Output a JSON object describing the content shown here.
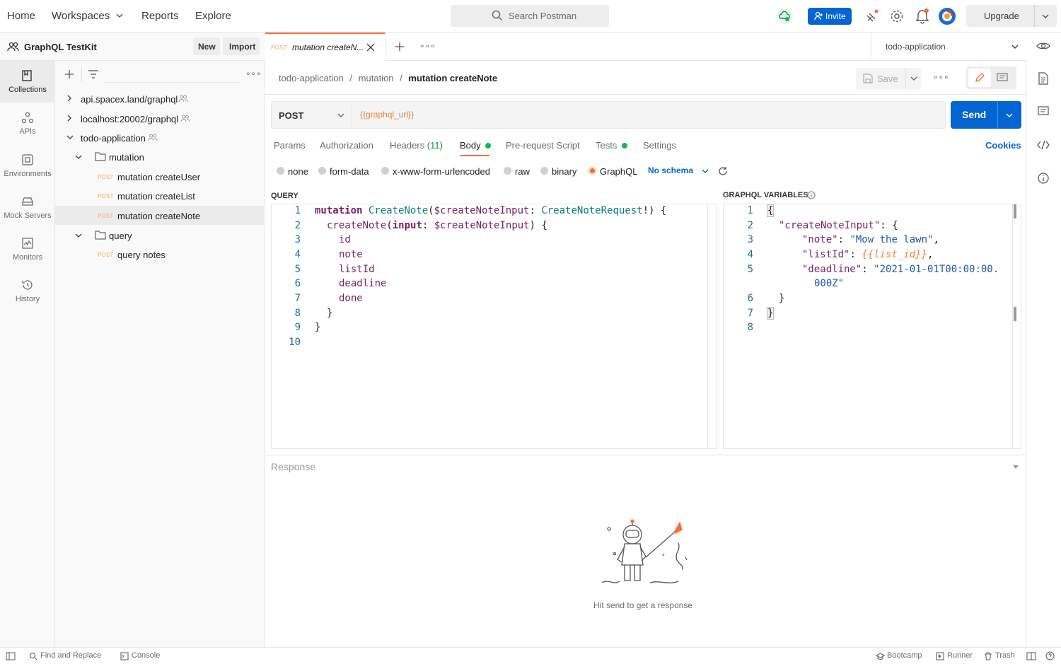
{
  "topbar": {
    "home": "Home",
    "workspaces": "Workspaces",
    "reports": "Reports",
    "explore": "Explore",
    "search_placeholder": "Search Postman",
    "invite": "Invite",
    "upgrade": "Upgrade"
  },
  "sidebar": {
    "workspace_name": "GraphQL TestKit",
    "new_label": "New",
    "import_label": "Import",
    "rail": [
      {
        "label": "Collections",
        "icon": "collections-icon"
      },
      {
        "label": "APIs",
        "icon": "apis-icon"
      },
      {
        "label": "Environments",
        "icon": "environments-icon"
      },
      {
        "label": "Mock Servers",
        "icon": "mock-servers-icon"
      },
      {
        "label": "Monitors",
        "icon": "monitors-icon"
      },
      {
        "label": "History",
        "icon": "history-icon"
      }
    ],
    "collections": [
      {
        "name": "api.spacex.land/graphql"
      },
      {
        "name": "localhost:20002/graphql"
      },
      {
        "name": "todo-application"
      }
    ],
    "folders": [
      {
        "name": "mutation"
      },
      {
        "name": "query"
      }
    ],
    "requests": [
      {
        "method": "POST",
        "name": "mutation createUser"
      },
      {
        "method": "POST",
        "name": "mutation createList"
      },
      {
        "method": "POST",
        "name": "mutation createNote"
      },
      {
        "method": "POST",
        "name": "query notes"
      }
    ]
  },
  "tab": {
    "method": "POST",
    "title": "mutation createN..."
  },
  "environment": "todo-application",
  "breadcrumb": {
    "collection": "todo-application",
    "folder": "mutation",
    "request": "mutation createNote",
    "sep1": "/",
    "sep2": "/"
  },
  "save_label": "Save",
  "request": {
    "method": "POST",
    "url": "{{graphql_url}}",
    "send": "Send"
  },
  "req_tabs": {
    "params": "Params",
    "authorization": "Authorization",
    "headers": "Headers",
    "headers_count": "(11)",
    "body": "Body",
    "prerequest": "Pre-request Script",
    "tests": "Tests",
    "settings": "Settings",
    "cookies": "Cookies"
  },
  "body_types": {
    "none": "none",
    "form_data": "form-data",
    "urlencoded": "x-www-form-urlencoded",
    "raw": "raw",
    "binary": "binary",
    "graphql": "GraphQL",
    "schema": "No schema"
  },
  "query_label": "QUERY",
  "variables_label": "GRAPHQL VARIABLES",
  "query_lines": [
    "1",
    "2",
    "3",
    "4",
    "5",
    "6",
    "7",
    "8",
    "9",
    "10"
  ],
  "variables_lines": [
    "1",
    "2",
    "3",
    "4",
    "5",
    "",
    "6",
    "7",
    "8"
  ],
  "query_code": {
    "l1_kw": "mutation",
    "l1_name": "CreateNote",
    "l1_open": "(",
    "l1_var": "$createNoteInput",
    "l1_colon": ": ",
    "l1_type": "CreateNoteRequest",
    "l1_close": "!) {",
    "l2_fn": "createNote",
    "l2_open": "(",
    "l2_arg": "input",
    "l2_colon": ": ",
    "l2_var": "$createNoteInput",
    "l2_close": ") {",
    "l3": "id",
    "l4": "note",
    "l5": "listId",
    "l6": "deadline",
    "l7": "done",
    "l8": "}",
    "l9": "}"
  },
  "variables_code": {
    "l1": "{",
    "l2_key": "\"createNoteInput\"",
    "l2_rest": ": {",
    "l3_key": "\"note\"",
    "l3_sep": ": ",
    "l3_val": "\"Mow the lawn\"",
    "l3_end": ",",
    "l4_key": "\"listId\"",
    "l4_sep": ": ",
    "l4_val": "{{list_id}}",
    "l4_end": ",",
    "l5_key": "\"deadline\"",
    "l5_sep": ": ",
    "l5_val": "\"2021-01-01T00:00:00.",
    "l5b_val": "000Z\"",
    "l6": "}",
    "l7": "}"
  },
  "response": {
    "label": "Response",
    "empty": "Hit send to get a response"
  },
  "statusbar": {
    "find_replace": "Find and Replace",
    "console": "Console",
    "bootcamp": "Bootcamp",
    "runner": "Runner",
    "trash": "Trash"
  },
  "colors": {
    "accent": "#0265d2",
    "post": "#f0a86a",
    "active_tab": "#ff6c37",
    "green_dot": "#0cbb52"
  }
}
